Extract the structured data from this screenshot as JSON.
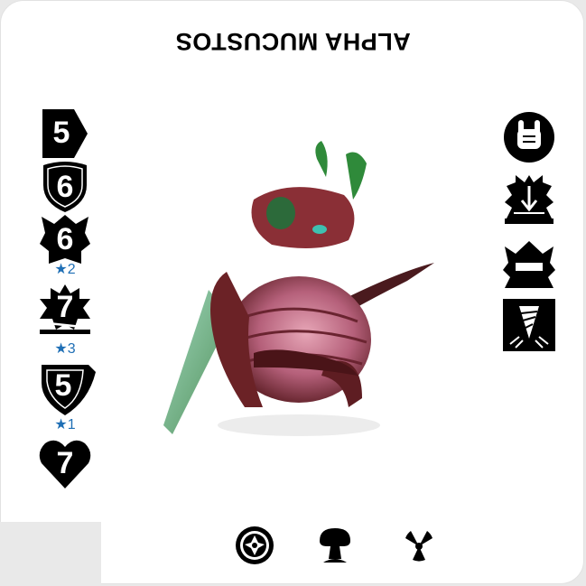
{
  "card": {
    "name": "ALPHA MUCUSTOS"
  },
  "stats": [
    {
      "label": "speed",
      "value": "5",
      "star": ""
    },
    {
      "label": "attack",
      "value": "6",
      "star": ""
    },
    {
      "label": "defense",
      "value": "6",
      "star": "★2"
    },
    {
      "label": "attack-modifier",
      "value": "7",
      "star": "★3"
    },
    {
      "label": "range-defense",
      "value": "5",
      "star": "★1"
    },
    {
      "label": "health",
      "value": "7",
      "star": ""
    }
  ],
  "abilities": [
    {
      "icon": "rock-hand-icon"
    },
    {
      "icon": "arrow-down-burst-icon"
    },
    {
      "icon": "minus-burst-icon"
    },
    {
      "icon": "drill-icon"
    }
  ],
  "bottom_icons": [
    {
      "icon": "gear-creature-icon"
    },
    {
      "icon": "mushroom-cloud-icon"
    },
    {
      "icon": "radiation-icon"
    }
  ],
  "colors": {
    "card_bg": "#ffffff",
    "stat_fill": "#000000",
    "star_blue": "#1f6fb5",
    "figure_maroon": "#7a2b2b",
    "figure_pink": "#c47a8a",
    "figure_green": "#2f8a3a"
  }
}
